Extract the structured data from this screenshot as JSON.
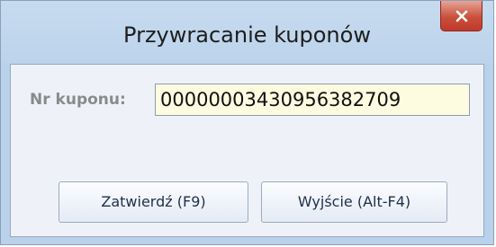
{
  "window": {
    "title": "Przywracanie kuponów",
    "close_icon": "close-icon"
  },
  "form": {
    "coupon_label": "Nr kuponu:",
    "coupon_value": "00000003430956382709"
  },
  "buttons": {
    "confirm_label": "Zatwierdź (F9)",
    "exit_label": "Wyjście (Alt-F4)"
  },
  "colors": {
    "input_background": "#fdfbe0",
    "close_button": "#c8503b",
    "frame": "#b9d1ea"
  }
}
